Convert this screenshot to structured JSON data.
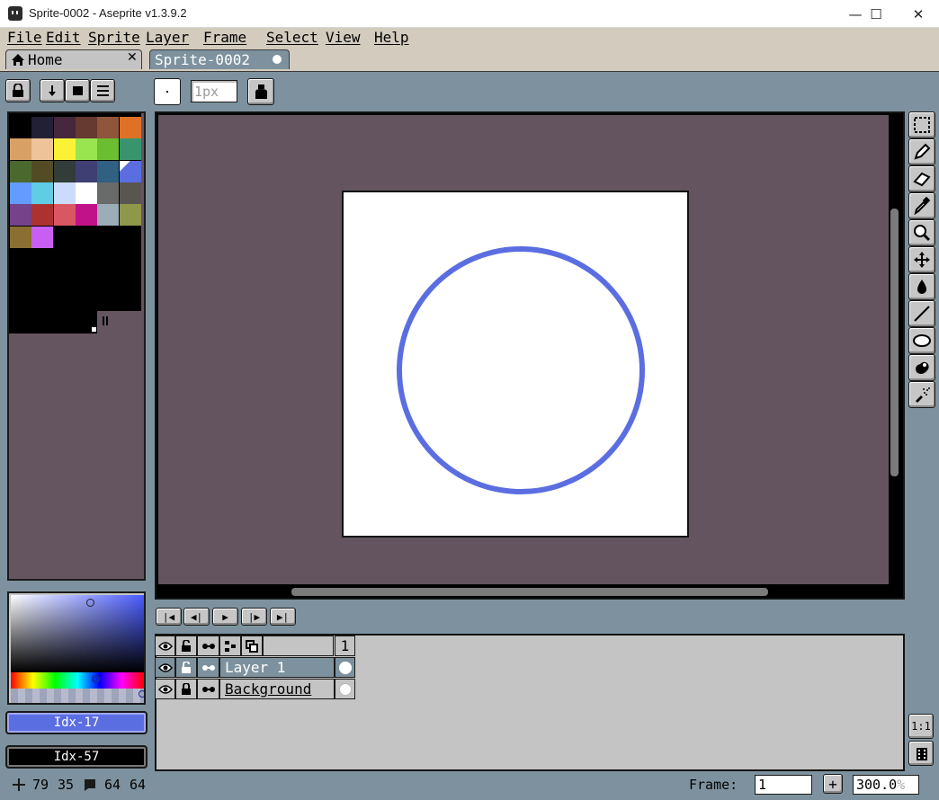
{
  "window": {
    "title": "Sprite-0002 - Aseprite v1.3.9.2",
    "minimize": "—",
    "maximize": "☐",
    "close": "✕"
  },
  "menu": [
    "File",
    "Edit",
    "Sprite",
    "Layer",
    "Frame",
    "Select",
    "View",
    "Help"
  ],
  "tabs": {
    "home_label": "Home",
    "home_close": "✕",
    "sprite_label": "Sprite-0002"
  },
  "toolbar": {
    "brush_size": "1px"
  },
  "palette": {
    "colors": [
      "#000000",
      "#222034",
      "#45283c",
      "#663931",
      "#8f563b",
      "#df7126",
      "#d9a066",
      "#eec39a",
      "#fbf236",
      "#99e550",
      "#6abe30",
      "#37946e",
      "#4b692f",
      "#524b24",
      "#323c39",
      "#3f3f74",
      "#306082",
      "#5b6ee1",
      "#639bff",
      "#5fcde4",
      "#cbdbfc",
      "#ffffff",
      "#696a6a",
      "#595652",
      "#76428a",
      "#ac3232",
      "#d95763",
      "#d77bba",
      "#8f974a",
      "#8a6f30",
      "#8a6f30",
      "#d77bff"
    ],
    "rows": [
      [
        "#000000",
        "#222034",
        "#45283c",
        "#663931",
        "#8f563b",
        "#df7126"
      ],
      [
        "#d9a066",
        "#eec39a",
        "#fbf236",
        "#99e550",
        "#6abe30",
        "#37946e"
      ],
      [
        "#4b692f",
        "#524b24",
        "#323c39",
        "#3f3f74",
        "#306082",
        "#5b6ee1"
      ],
      [
        "#639bff",
        "#5fcde4",
        "#cbdbfc",
        "#ffffff",
        "#696a6a",
        "#595652"
      ],
      [
        "#76428a",
        "#ac3232",
        "#d95763",
        "#c2128a",
        "#9badb7",
        "#8f974a"
      ],
      [
        "#8a6f30",
        "#c85ef2"
      ]
    ]
  },
  "colors": {
    "foreground_label": "Idx-17",
    "foreground_color": "#5b6ee1",
    "background_label": "Idx-57",
    "background_color": "#000000",
    "canvas_bg": "#63545f",
    "circle": "#5b6ee1"
  },
  "tools": [
    "rectangular-marquee",
    "pencil",
    "eraser",
    "eyedropper",
    "zoom",
    "move",
    "paint-bucket",
    "line",
    "ellipse",
    "blur",
    "spray"
  ],
  "timeline": {
    "frame_number": "1",
    "layers": [
      {
        "name": "Layer 1"
      },
      {
        "name": "Background"
      }
    ],
    "zoom_1_1": "1:1"
  },
  "status": {
    "cursor_x": "79",
    "cursor_y": "35",
    "size_w": "64",
    "size_h": "64",
    "frame_label": "Frame:",
    "frame_value": "1",
    "add_frame": "+",
    "zoom_value": "300.0",
    "zoom_unit": "%"
  }
}
